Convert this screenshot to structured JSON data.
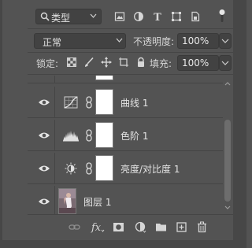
{
  "filter": {
    "kind_label": "类型"
  },
  "blend": {
    "mode": "正常",
    "opacity_label": "不透明度:",
    "opacity_value": "100%"
  },
  "lock": {
    "label": "锁定:",
    "fill_label": "填充:",
    "fill_value": "100%"
  },
  "layers": [
    {
      "name": "曲线",
      "number": "1",
      "type": "curves-icon"
    },
    {
      "name": "色阶",
      "number": "1",
      "type": "levels-icon"
    },
    {
      "name": "亮度/对比度",
      "number": "1",
      "type": "brightness-contrast-icon"
    },
    {
      "name": "图层",
      "number": "1",
      "type": "image-thumbnail"
    }
  ],
  "footer_icons": [
    "link-layers-icon",
    "fx-icon",
    "add-mask-icon",
    "adjustment-layer-icon",
    "new-group-icon",
    "new-layer-icon",
    "delete-icon"
  ],
  "colors": {
    "panel_bg": "#535353",
    "input_bg": "#424242",
    "text": "#d6d6d6",
    "border": "#454545"
  }
}
